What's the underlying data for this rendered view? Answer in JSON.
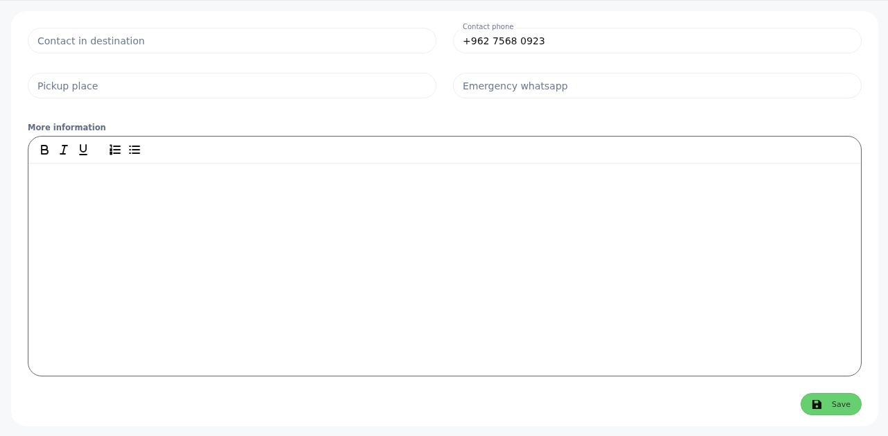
{
  "left_fields": [
    {
      "placeholder": "Contact in destination"
    },
    {
      "placeholder": "Pickup place"
    }
  ],
  "right_fields": [
    {
      "label": "Contact phone",
      "value": "+962 7568 0923"
    },
    {
      "placeholder": "Emergency whatsapp"
    }
  ],
  "editor": {
    "label": "More information",
    "toolbar": [
      {
        "kind": "bold"
      },
      {
        "kind": "italic"
      },
      {
        "kind": "underline"
      },
      {
        "kind": "ordered-list"
      },
      {
        "kind": "bullet-list"
      }
    ]
  },
  "save_button": {
    "label": "Save"
  }
}
